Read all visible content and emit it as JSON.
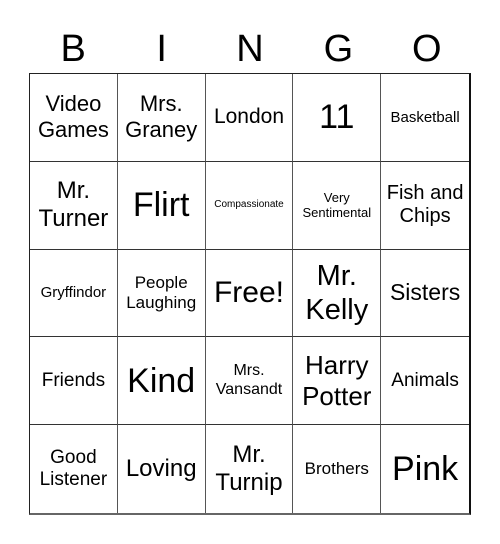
{
  "card": {
    "header": [
      "B",
      "I",
      "N",
      "G",
      "O"
    ],
    "cells": [
      {
        "text": "Video Games",
        "size": 22
      },
      {
        "text": "Mrs. Graney",
        "size": 22
      },
      {
        "text": "London",
        "size": 21
      },
      {
        "text": "11",
        "size": 34
      },
      {
        "text": "Basketball",
        "size": 15
      },
      {
        "text": "Mr. Turner",
        "size": 24
      },
      {
        "text": "Flirt",
        "size": 34
      },
      {
        "text": "Compassionate",
        "size": 10
      },
      {
        "text": "Very Sentimental",
        "size": 13
      },
      {
        "text": "Fish and Chips",
        "size": 20
      },
      {
        "text": "Gryffindor",
        "size": 15
      },
      {
        "text": "People Laughing",
        "size": 17
      },
      {
        "text": "Free!",
        "size": 30
      },
      {
        "text": "Mr. Kelly",
        "size": 29
      },
      {
        "text": "Sisters",
        "size": 23
      },
      {
        "text": "Friends",
        "size": 19
      },
      {
        "text": "Kind",
        "size": 34
      },
      {
        "text": "Mrs. Vansandt",
        "size": 16
      },
      {
        "text": "Harry Potter",
        "size": 26
      },
      {
        "text": "Animals",
        "size": 19
      },
      {
        "text": "Good Listener",
        "size": 19
      },
      {
        "text": "Loving",
        "size": 24
      },
      {
        "text": "Mr. Turnip",
        "size": 24
      },
      {
        "text": "Brothers",
        "size": 17
      },
      {
        "text": "Pink",
        "size": 34
      }
    ]
  }
}
